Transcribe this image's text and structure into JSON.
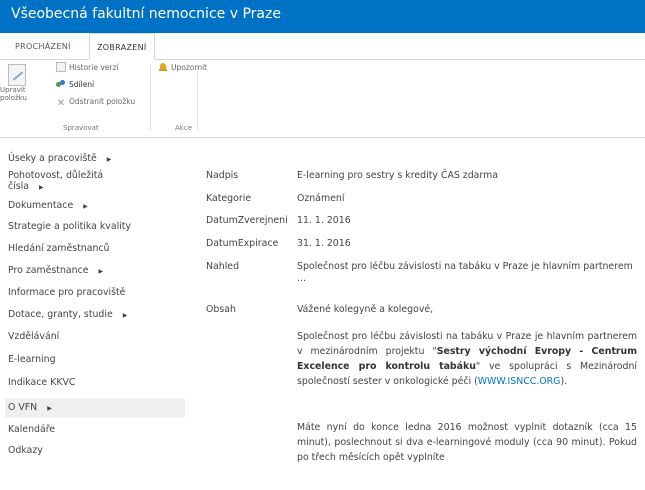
{
  "app": {
    "title": "Všeobecná fakultní nemocnice v Praze"
  },
  "ribbon_tabs": [
    {
      "label": "PROCHÁZENÍ"
    },
    {
      "label": "ZOBRAZENÍ"
    }
  ],
  "ribbon": {
    "edit_item": "Upravit\npoložku",
    "version_history": "Historie verzí",
    "share": "Sdílení",
    "delete_item": "Odstranit položku",
    "alert": "Upozornit",
    "group_manage": "Spravovat",
    "group_actions": "Akce"
  },
  "nav": [
    {
      "label": "Úseky a pracoviště",
      "arrow": "▶"
    },
    {
      "label": "Pohotovost, důležitá",
      "label2": "čísla",
      "arrow": "▶"
    },
    {
      "label": "Dokumentace",
      "arrow": "▶"
    },
    {
      "label": "Strategie a politika kvality"
    },
    {
      "label": "Hledání zaměstnanců"
    },
    {
      "label": "Pro zaměstnance",
      "arrow": "▶"
    },
    {
      "label": "Informace pro pracoviště"
    },
    {
      "label": "Dotace, granty, studie",
      "arrow": "▶"
    },
    {
      "label": "Vzdělávání"
    },
    {
      "label": "E-learning"
    },
    {
      "label": "Indikace KKVC"
    },
    {
      "label": "O VFN",
      "arrow": "▶"
    },
    {
      "label": "Kalendáře"
    },
    {
      "label": "Odkazy"
    }
  ],
  "fields": {
    "nadpis": {
      "label": "Nadpis",
      "value": "E-learning pro sestry s kredity ČAS zdarma"
    },
    "kategorie": {
      "label": "Kategorie",
      "value": "Oznámení"
    },
    "datum_zverejneni": {
      "label": "DatumZverejneni",
      "value": "11. 1. 2016"
    },
    "datum_expirace": {
      "label": "DatumExpirace",
      "value": "31. 1. 2016"
    },
    "nahled": {
      "label": "Nahled",
      "value": "Společnost pro léčbu závislosti na tabáku v Praze je hlavním partnerem ..."
    },
    "obsah": {
      "label": "Obsah",
      "greeting": "Vážené kolegyně a kolegové,",
      "p1_a": "Společnost pro léčbu závislosti na tabáku v Praze je hlavním partnerem v mezinárodním projektu \"",
      "p1_bold": "Sestry východní Evropy - Centrum Excelence pro kontrolu tabáku",
      "p1_b": "\" ve spolupráci s Mezinárodní společností sester v onkologické péči (",
      "p1_link": "WWW.ISNCC.ORG",
      "p1_c": ").",
      "p2": "Máte nyní do konce ledna 2016 možnost vyplnit dotazník (cca 15 minut), poslechnout si dva e-learningové moduly (cca 90 minut). Pokud po třech měsících opět vyplníte"
    }
  },
  "colors": {
    "brand": "#0072c6",
    "link": "#0072c6"
  }
}
